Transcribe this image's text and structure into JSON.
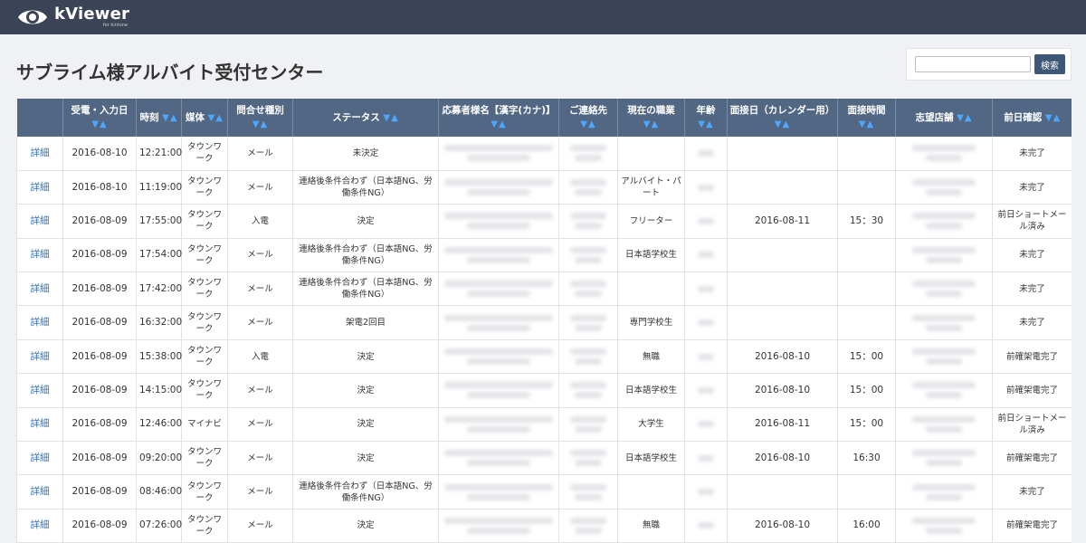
{
  "app": {
    "name": "kViewer",
    "sub": "for kintone"
  },
  "page": {
    "title": "サブライム様アルバイト受付センター"
  },
  "search": {
    "placeholder": "",
    "button": "検索"
  },
  "table": {
    "columns": [
      {
        "key": "detail",
        "label": ""
      },
      {
        "key": "date",
        "label": "受電・入力日"
      },
      {
        "key": "time",
        "label": "時刻"
      },
      {
        "key": "media",
        "label": "媒体"
      },
      {
        "key": "type",
        "label": "問合せ種別"
      },
      {
        "key": "status",
        "label": "ステータス"
      },
      {
        "key": "name",
        "label": "応募者様名【漢字(カナ)】"
      },
      {
        "key": "contact",
        "label": "ご連絡先"
      },
      {
        "key": "job",
        "label": "現在の職業"
      },
      {
        "key": "age",
        "label": "年齢"
      },
      {
        "key": "idate",
        "label": "面接日（カレンダー用）"
      },
      {
        "key": "itime",
        "label": "面接時間"
      },
      {
        "key": "store",
        "label": "志望店舗"
      },
      {
        "key": "confirm",
        "label": "前日確認"
      }
    ],
    "rows": [
      {
        "detail": "詳細",
        "date": "2016-08-10",
        "time": "12:21:00",
        "media": "タウンワーク",
        "type": "メール",
        "status": "未決定",
        "job": "",
        "idate": "",
        "itime": "",
        "confirm": "未完了"
      },
      {
        "detail": "詳細",
        "date": "2016-08-10",
        "time": "11:19:00",
        "media": "タウンワーク",
        "type": "メール",
        "status": "連絡後条件合わず（日本語NG、労働条件NG）",
        "job": "アルバイト・パート",
        "idate": "",
        "itime": "",
        "confirm": "未完了"
      },
      {
        "detail": "詳細",
        "date": "2016-08-09",
        "time": "17:55:00",
        "media": "タウンワーク",
        "type": "入電",
        "status": "決定",
        "job": "フリーター",
        "idate": "2016-08-11",
        "itime": "15：30",
        "confirm": "前日ショートメール済み"
      },
      {
        "detail": "詳細",
        "date": "2016-08-09",
        "time": "17:54:00",
        "media": "タウンワーク",
        "type": "メール",
        "status": "連絡後条件合わず（日本語NG、労働条件NG）",
        "job": "日本語学校生",
        "idate": "",
        "itime": "",
        "confirm": "未完了"
      },
      {
        "detail": "詳細",
        "date": "2016-08-09",
        "time": "17:42:00",
        "media": "タウンワーク",
        "type": "メール",
        "status": "連絡後条件合わず（日本語NG、労働条件NG）",
        "job": "",
        "idate": "",
        "itime": "",
        "confirm": "未完了"
      },
      {
        "detail": "詳細",
        "date": "2016-08-09",
        "time": "16:32:00",
        "media": "タウンワーク",
        "type": "メール",
        "status": "架電2回目",
        "job": "専門学校生",
        "idate": "",
        "itime": "",
        "confirm": "未完了"
      },
      {
        "detail": "詳細",
        "date": "2016-08-09",
        "time": "15:38:00",
        "media": "タウンワーク",
        "type": "入電",
        "status": "決定",
        "job": "無職",
        "idate": "2016-08-10",
        "itime": "15：00",
        "confirm": "前確架電完了"
      },
      {
        "detail": "詳細",
        "date": "2016-08-09",
        "time": "14:15:00",
        "media": "タウンワーク",
        "type": "メール",
        "status": "決定",
        "job": "日本語学校生",
        "idate": "2016-08-10",
        "itime": "15：00",
        "confirm": "前確架電完了"
      },
      {
        "detail": "詳細",
        "date": "2016-08-09",
        "time": "12:46:00",
        "media": "マイナビ",
        "type": "メール",
        "status": "決定",
        "job": "大学生",
        "idate": "2016-08-11",
        "itime": "15：00",
        "confirm": "前日ショートメール済み"
      },
      {
        "detail": "詳細",
        "date": "2016-08-09",
        "time": "09:20:00",
        "media": "タウンワーク",
        "type": "メール",
        "status": "決定",
        "job": "日本語学校生",
        "idate": "2016-08-10",
        "itime": "16:30",
        "confirm": "前確架電完了"
      },
      {
        "detail": "詳細",
        "date": "2016-08-09",
        "time": "08:46:00",
        "media": "タウンワーク",
        "type": "メール",
        "status": "連絡後条件合わず（日本語NG、労働条件NG）",
        "job": "",
        "idate": "",
        "itime": "",
        "confirm": "未完了"
      },
      {
        "detail": "詳細",
        "date": "2016-08-09",
        "time": "07:26:00",
        "media": "タウンワーク",
        "type": "メール",
        "status": "決定",
        "job": "無職",
        "idate": "2016-08-10",
        "itime": "16:00",
        "confirm": "前確架電完了"
      }
    ]
  },
  "colors": {
    "topbar": "#3b4456",
    "header": "#516784",
    "sort_arrow": "#4da6ff",
    "link": "#2f6fb5",
    "button": "#3d5877"
  }
}
